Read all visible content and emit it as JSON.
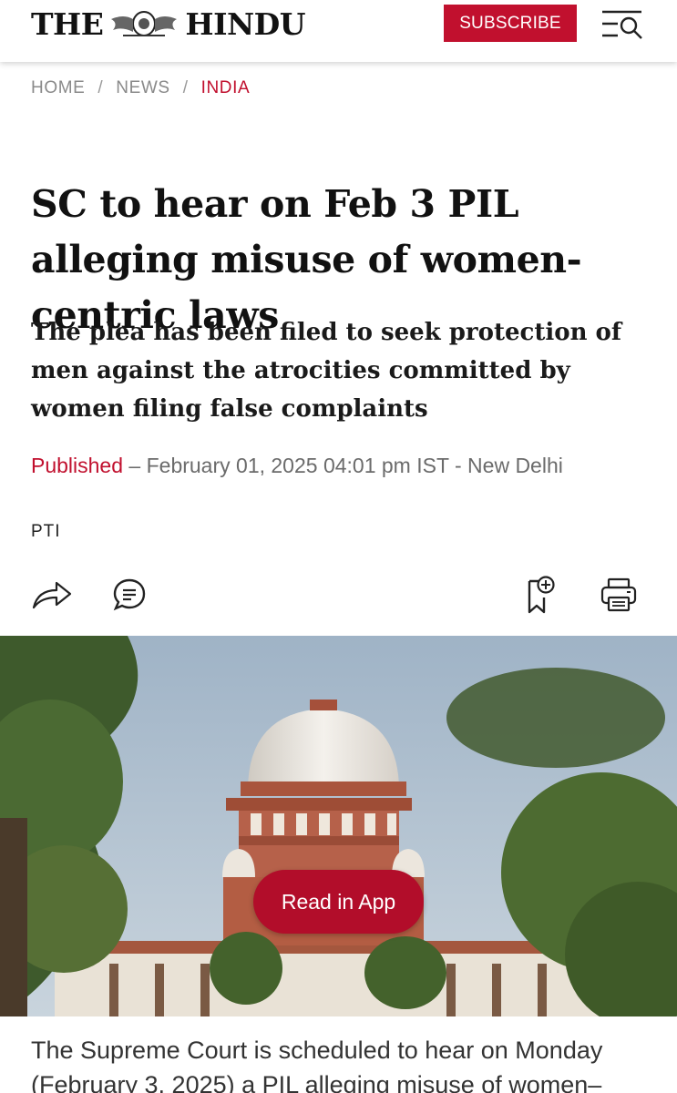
{
  "header": {
    "logo_left": "THE",
    "logo_right": "HINDU",
    "subscribe_label": "SUBSCRIBE",
    "menu_icon": "menu-search-icon"
  },
  "breadcrumb": {
    "items": [
      "HOME",
      "NEWS",
      "INDIA"
    ],
    "separator": "/"
  },
  "article": {
    "headline": "SC to hear on Feb 3 PIL alleging misuse of women-centric laws",
    "subheadline": "The plea has been filed to seek protection of men against the atrocities committed by women filing false complaints",
    "published_label": "Published",
    "published_meta": " – February 01, 2025 04:01 pm IST - New Delhi",
    "author": "PTI",
    "body": "The Supreme Court is scheduled to hear on Monday (February 3, 2025) a PIL alleging misuse of women–"
  },
  "actions": {
    "share_icon": "share-icon",
    "comment_icon": "comment-icon",
    "bookmark_icon": "bookmark-add-icon",
    "print_icon": "print-icon"
  },
  "cta": {
    "read_in_app": "Read in App"
  },
  "colors": {
    "brand_red": "#c1102e",
    "meta_gray": "#6b6b6b"
  }
}
